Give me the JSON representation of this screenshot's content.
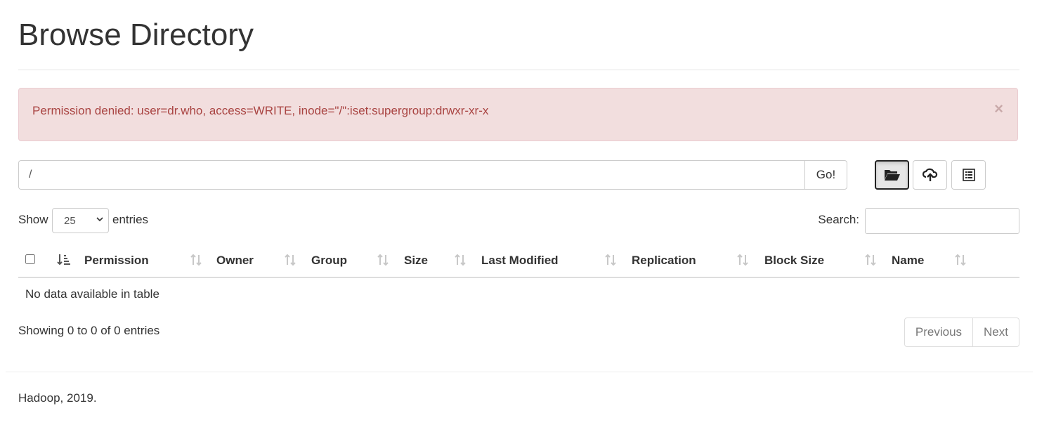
{
  "page": {
    "title": "Browse Directory"
  },
  "alert": {
    "message": "Permission denied: user=dr.who, access=WRITE, inode=\"/\":iset:supergroup:drwxr-xr-x",
    "close_symbol": "×"
  },
  "path_bar": {
    "value": "/",
    "go_label": "Go!"
  },
  "toolbar": {
    "buttons": [
      {
        "icon": "folder-open-icon",
        "active": true
      },
      {
        "icon": "cloud-upload-icon",
        "active": false
      },
      {
        "icon": "list-alt-icon",
        "active": false
      }
    ]
  },
  "length_control": {
    "show_label": "Show",
    "selected": "25",
    "entries_label": "entries"
  },
  "search": {
    "label": "Search:",
    "value": ""
  },
  "table": {
    "columns": [
      "Permission",
      "Owner",
      "Group",
      "Size",
      "Last Modified",
      "Replication",
      "Block Size",
      "Name"
    ],
    "empty_message": "No data available in table"
  },
  "info": "Showing 0 to 0 of 0 entries",
  "pagination": {
    "previous": "Previous",
    "next": "Next"
  },
  "footer": {
    "text": "Hadoop, 2019."
  },
  "colors": {
    "alert_bg": "#f2dede",
    "alert_text": "#a94442",
    "sort_icon": "#c8c8c8"
  }
}
